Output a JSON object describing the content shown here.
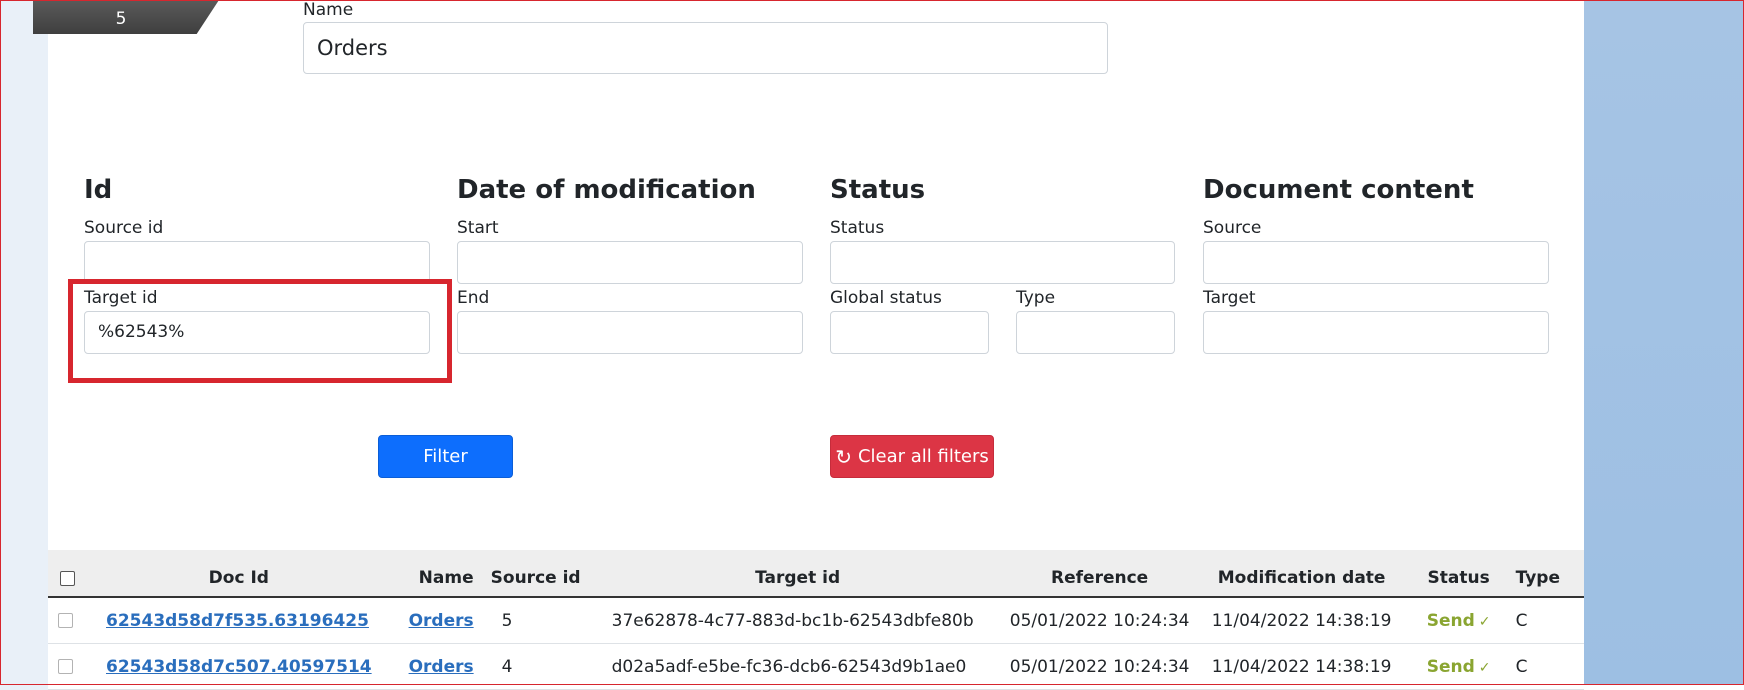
{
  "step": {
    "number": "5"
  },
  "name_field": {
    "label": "Name",
    "value": "Orders"
  },
  "filters": {
    "id": {
      "heading": "Id",
      "source_label": "Source id",
      "source_value": "",
      "target_label": "Target id",
      "target_value": "%62543%"
    },
    "date": {
      "heading": "Date of modification",
      "start_label": "Start",
      "start_value": "",
      "end_label": "End",
      "end_value": ""
    },
    "status": {
      "heading": "Status",
      "status_label": "Status",
      "status_value": "",
      "global_label": "Global status",
      "global_value": "",
      "type_label": "Type",
      "type_value": ""
    },
    "content": {
      "heading": "Document content",
      "source_label": "Source",
      "source_value": "",
      "target_label": "Target",
      "target_value": ""
    }
  },
  "buttons": {
    "filter": "Filter",
    "clear": "Clear all filters",
    "clear_icon": "refresh-icon"
  },
  "table": {
    "headers": [
      "Doc Id",
      "Name",
      "Source id",
      "Target id",
      "Reference",
      "Modification date",
      "Status",
      "Type"
    ],
    "rows": [
      {
        "doc_id": "62543d58d7f535.63196425",
        "name": "Orders",
        "source_id": "5",
        "target_id": "37e62878-4c77-883d-bc1b-62543dbfe80b",
        "reference": "05/01/2022 10:24:34",
        "mod_date": "11/04/2022 14:38:19",
        "status": "Send",
        "type": "C"
      },
      {
        "doc_id": "62543d58d7c507.40597514",
        "name": "Orders",
        "source_id": "4",
        "target_id": "d02a5adf-e5be-fc36-dcb6-62543d9b1ae0",
        "reference": "05/01/2022 10:24:34",
        "mod_date": "11/04/2022 14:38:19",
        "status": "Send",
        "type": "C"
      }
    ]
  },
  "colors": {
    "primary": "#0d6efd",
    "danger": "#dc3545",
    "link": "#2a6ebd",
    "status_send": "#8aa531",
    "highlight": "#d7262e"
  }
}
